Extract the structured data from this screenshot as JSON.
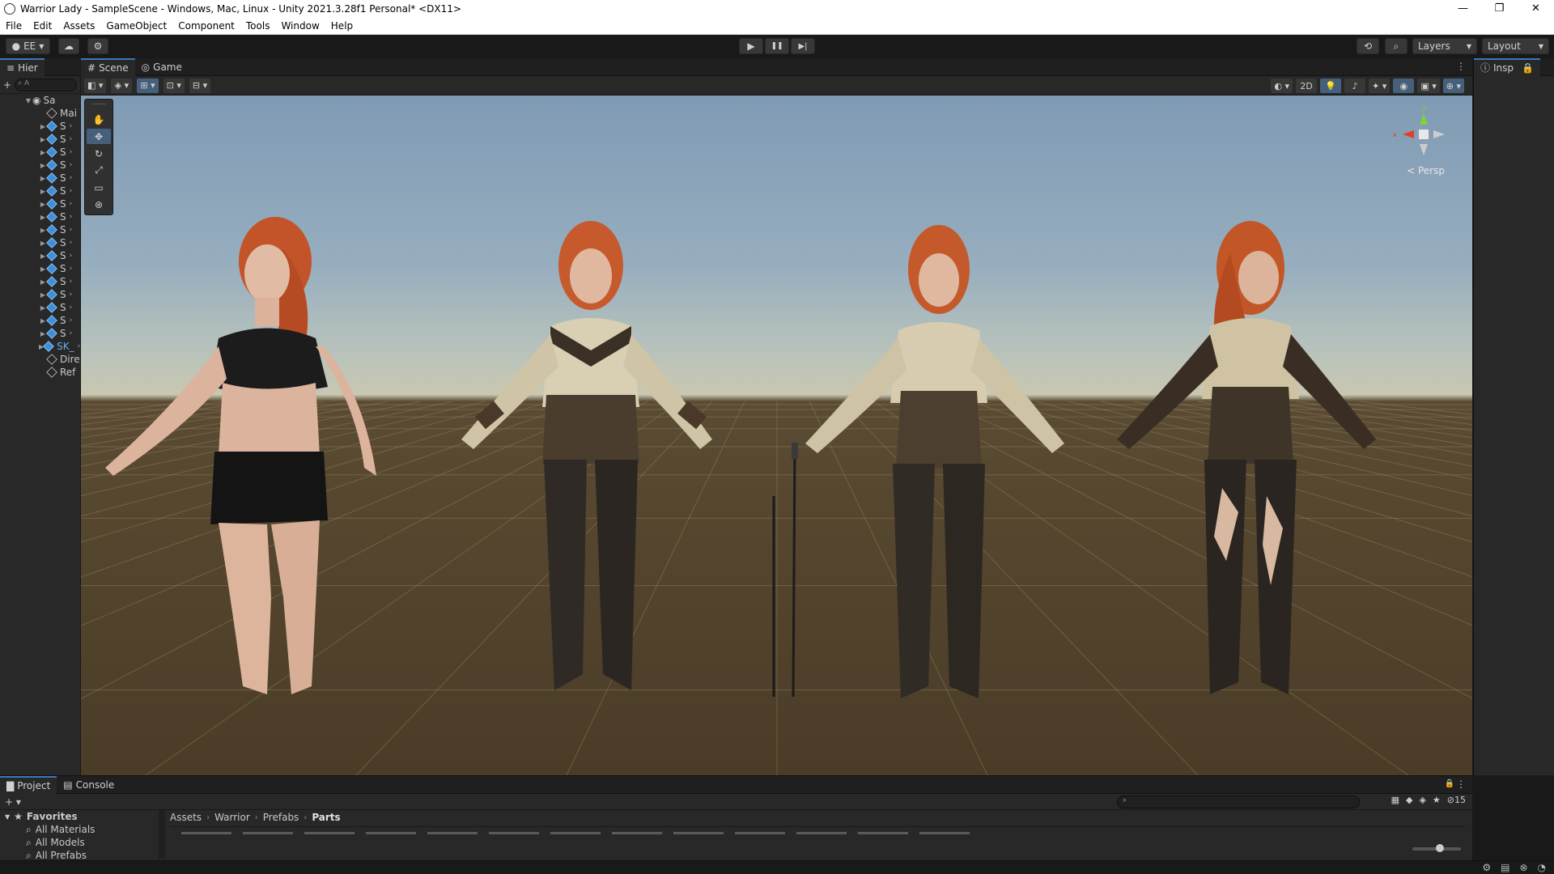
{
  "window": {
    "title": "Warrior Lady - SampleScene - Windows, Mac, Linux - Unity 2021.3.28f1 Personal* <DX11>",
    "controls": {
      "minimize": "—",
      "maximize": "❐",
      "close": "✕"
    }
  },
  "menu": [
    "File",
    "Edit",
    "Assets",
    "GameObject",
    "Component",
    "Tools",
    "Window",
    "Help"
  ],
  "toolbar": {
    "account_label": "EE",
    "play_icon": "▶",
    "pause_icon": "❚❚",
    "step_icon": "▶|",
    "layers_label": "Layers",
    "layout_label": "Layout"
  },
  "hierarchy": {
    "tab_label": "Hier",
    "search_placeholder": "A",
    "scene_name": "Sa",
    "items": [
      {
        "label": "Mai",
        "icon": "gameobject-icon",
        "expandable": false
      },
      {
        "label": "S",
        "icon": "prefab-icon",
        "expandable": true
      },
      {
        "label": "S",
        "icon": "prefab-icon",
        "expandable": true
      },
      {
        "label": "S",
        "icon": "prefab-icon",
        "expandable": true
      },
      {
        "label": "S",
        "icon": "prefab-icon",
        "expandable": true
      },
      {
        "label": "S",
        "icon": "prefab-icon",
        "expandable": true
      },
      {
        "label": "S",
        "icon": "prefab-icon",
        "expandable": true
      },
      {
        "label": "S",
        "icon": "prefab-icon",
        "expandable": true
      },
      {
        "label": "S",
        "icon": "prefab-icon",
        "expandable": true
      },
      {
        "label": "S",
        "icon": "prefab-icon",
        "expandable": true
      },
      {
        "label": "S",
        "icon": "prefab-icon",
        "expandable": true
      },
      {
        "label": "S",
        "icon": "prefab-icon",
        "expandable": true
      },
      {
        "label": "S",
        "icon": "prefab-icon",
        "expandable": true
      },
      {
        "label": "S",
        "icon": "prefab-icon",
        "expandable": true
      },
      {
        "label": "S",
        "icon": "prefab-icon",
        "expandable": true
      },
      {
        "label": "S",
        "icon": "prefab-icon",
        "expandable": true
      },
      {
        "label": "S",
        "icon": "prefab-icon",
        "expandable": true
      },
      {
        "label": "S",
        "icon": "prefab-icon",
        "expandable": true
      },
      {
        "label": "SK_",
        "icon": "prefab-icon",
        "expandable": true,
        "highlight": true
      },
      {
        "label": "Dire",
        "icon": "gameobject-icon",
        "expandable": false
      },
      {
        "label": "Ref",
        "icon": "gameobject-icon",
        "expandable": false
      }
    ]
  },
  "scene_view": {
    "tabs": [
      {
        "label": "Scene",
        "icon": "grid-icon",
        "active": true
      },
      {
        "label": "Game",
        "icon": "gamepad-icon",
        "active": false
      }
    ],
    "toggle_2d_label": "2D",
    "projection_label": "< Persp",
    "gizmo_axes": {
      "x": "x",
      "y": "y"
    },
    "colors": {
      "axis_x": "#e0402a",
      "axis_y": "#7fd23a",
      "axis_z": "#3a7bd5"
    }
  },
  "inspector": {
    "tab_label": "Insp"
  },
  "project": {
    "tabs": [
      {
        "label": "Project",
        "icon": "folder-icon",
        "active": true
      },
      {
        "label": "Console",
        "icon": "console-icon",
        "active": false
      }
    ],
    "hidden_count": "15",
    "favorites_label": "Favorites",
    "favorites": [
      "All Materials",
      "All Models",
      "All Prefabs"
    ],
    "breadcrumb": [
      "Assets",
      "Warrior",
      "Prefabs",
      "Parts"
    ]
  },
  "colors": {
    "accent": "#3a79bb",
    "panel_bg": "#282828",
    "selection": "#46607c"
  }
}
